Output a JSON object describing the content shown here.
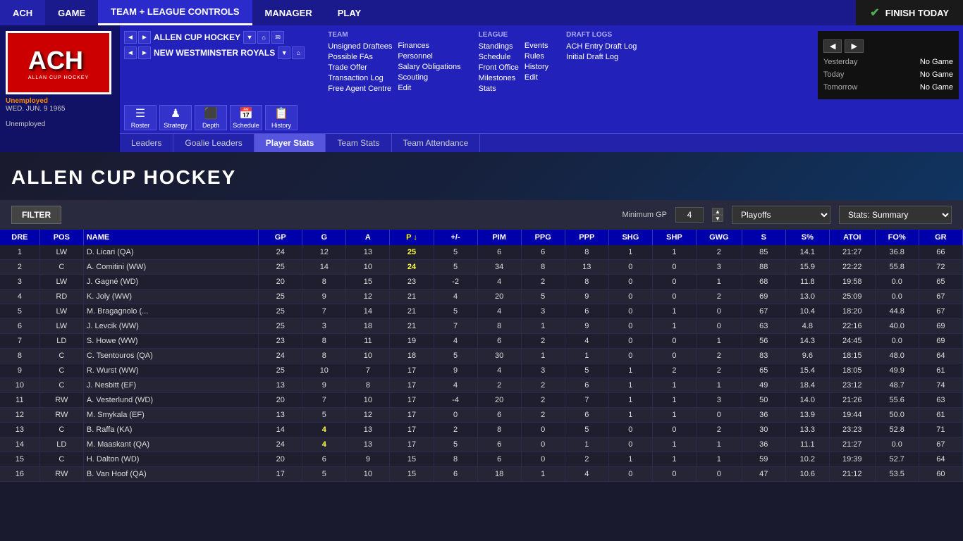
{
  "topNav": {
    "items": [
      {
        "id": "ach",
        "label": "ACH",
        "active": false
      },
      {
        "id": "game",
        "label": "GAME",
        "active": false
      },
      {
        "id": "team-league",
        "label": "TEAM + LEAGUE CONTROLS",
        "active": true
      },
      {
        "id": "manager",
        "label": "MANAGER",
        "active": false
      },
      {
        "id": "play",
        "label": "PLAY",
        "active": false
      }
    ],
    "finishToday": "FINISH TODAY"
  },
  "breadcrumbs": {
    "row1": {
      "text": "ALLEN CUP HOCKEY",
      "icons": [
        "▼",
        "⌂",
        "✉"
      ]
    },
    "row2": {
      "text": "NEW WESTMINSTER ROYALS",
      "icons": [
        "▼",
        "⌂"
      ]
    }
  },
  "iconButtons": [
    {
      "symbol": "☰",
      "label": "Roster"
    },
    {
      "symbol": "♟",
      "label": "Strategy"
    },
    {
      "symbol": "⬛",
      "label": "Depth"
    },
    {
      "symbol": "📅",
      "label": "Schedule"
    },
    {
      "symbol": "📋",
      "label": "History"
    }
  ],
  "teamMenu": {
    "title": "TEAM",
    "links": [
      "Unsigned Draftees",
      "Possible FAs",
      "Trade Offer",
      "Transaction Log",
      "Free Agent Centre"
    ]
  },
  "financesMenu": {
    "links": [
      "Finances",
      "Personnel",
      "Salary Obligations",
      "Scouting",
      "Edit"
    ]
  },
  "leagueMenu": {
    "title": "LEAGUE",
    "links": [
      "Standings",
      "Schedule",
      "Front Office",
      "Milestones",
      "Stats"
    ]
  },
  "eventsMenu": {
    "links": [
      "Events",
      "Rules",
      "History",
      "Edit"
    ]
  },
  "draftLogsMenu": {
    "title": "DRAFT LOGS",
    "links": [
      "ACH Entry Draft Log",
      "Initial Draft Log"
    ]
  },
  "sidebar": {
    "logoText": "ACH",
    "logoSubtitle": "ALLAN CUP HOCKEY",
    "userStatus": "Unemployed",
    "userDate": "WED. JUN. 9 1965",
    "userRole": "Unemployed"
  },
  "subNavTabs": [
    {
      "label": "Leaders",
      "active": false
    },
    {
      "label": "Goalie Leaders",
      "active": false
    },
    {
      "label": "Player Stats",
      "active": true
    },
    {
      "label": "Team Stats",
      "active": false
    },
    {
      "label": "Team Attendance",
      "active": false
    }
  ],
  "pageTitle": "ALLEN CUP HOCKEY",
  "filterBar": {
    "filterLabel": "FILTER",
    "minGpLabel": "Minimum GP",
    "minGpValue": "4",
    "playoffOption": "Playoffs",
    "statsOption": "Stats: Summary"
  },
  "finishTodayPanel": {
    "prevBtn": "◀",
    "nextBtn": "▶",
    "rows": [
      {
        "label": "Yesterday",
        "value": "No Game"
      },
      {
        "label": "Today",
        "value": "No Game"
      },
      {
        "label": "Tomorrow",
        "value": "No Game"
      }
    ]
  },
  "tableHeaders": [
    "DRE",
    "POS",
    "NAME",
    "GP",
    "G",
    "A",
    "P",
    "+/-",
    "PIM",
    "PPG",
    "PPP",
    "SHG",
    "SHP",
    "GWG",
    "S",
    "S%",
    "ATOI",
    "FO%",
    "GR"
  ],
  "tableRows": [
    {
      "dre": "1",
      "pos": "LW",
      "name": "D. Licari (QA)",
      "gp": "24",
      "g": "12",
      "a": "13",
      "p": "25",
      "pm": "5",
      "pim": "6",
      "ppg": "6",
      "ppp": "8",
      "shg": "1",
      "shp": "1",
      "gwg": "2",
      "s": "85",
      "sp": "14.1",
      "atoi": "21:27",
      "fop": "36.8",
      "gr": "66",
      "highlight_p": true
    },
    {
      "dre": "2",
      "pos": "C",
      "name": "A. Comitini (WW)",
      "gp": "25",
      "g": "14",
      "a": "10",
      "p": "24",
      "pm": "5",
      "pim": "34",
      "ppg": "8",
      "ppp": "13",
      "shg": "0",
      "shp": "0",
      "gwg": "3",
      "s": "88",
      "sp": "15.9",
      "atoi": "22:22",
      "fop": "55.8",
      "gr": "72",
      "highlight_p": true
    },
    {
      "dre": "3",
      "pos": "LW",
      "name": "J. Gagné (WD)",
      "gp": "20",
      "g": "8",
      "a": "15",
      "p": "23",
      "pm": "-2",
      "pim": "4",
      "ppg": "2",
      "ppp": "8",
      "shg": "0",
      "shp": "0",
      "gwg": "1",
      "s": "68",
      "sp": "11.8",
      "atoi": "19:58",
      "fop": "0.0",
      "gr": "65"
    },
    {
      "dre": "4",
      "pos": "RD",
      "name": "K. Joly (WW)",
      "gp": "25",
      "g": "9",
      "a": "12",
      "p": "21",
      "pm": "4",
      "pim": "20",
      "ppg": "5",
      "ppp": "9",
      "shg": "0",
      "shp": "0",
      "gwg": "2",
      "s": "69",
      "sp": "13.0",
      "atoi": "25:09",
      "fop": "0.0",
      "gr": "67",
      "highlight_pm": true
    },
    {
      "dre": "5",
      "pos": "LW",
      "name": "M. Bragagnolo (...",
      "gp": "25",
      "g": "7",
      "a": "14",
      "p": "21",
      "pm": "5",
      "pim": "4",
      "ppg": "3",
      "ppp": "6",
      "shg": "0",
      "shp": "1",
      "gwg": "0",
      "s": "67",
      "sp": "10.4",
      "atoi": "18:20",
      "fop": "44.8",
      "gr": "67"
    },
    {
      "dre": "6",
      "pos": "LW",
      "name": "J. Levcik (WW)",
      "gp": "25",
      "g": "3",
      "a": "18",
      "p": "21",
      "pm": "7",
      "pim": "8",
      "ppg": "1",
      "ppp": "9",
      "shg": "0",
      "shp": "1",
      "gwg": "0",
      "s": "63",
      "sp": "4.8",
      "atoi": "22:16",
      "fop": "40.0",
      "gr": "69"
    },
    {
      "dre": "7",
      "pos": "LD",
      "name": "S. Howe (WW)",
      "gp": "23",
      "g": "8",
      "a": "11",
      "p": "19",
      "pm": "4",
      "pim": "6",
      "ppg": "2",
      "ppp": "4",
      "shg": "0",
      "shp": "0",
      "gwg": "1",
      "s": "56",
      "sp": "14.3",
      "atoi": "24:45",
      "fop": "0.0",
      "gr": "69",
      "highlight_pm": true
    },
    {
      "dre": "8",
      "pos": "C",
      "name": "C. Tsentouros (QA)",
      "gp": "24",
      "g": "8",
      "a": "10",
      "p": "18",
      "pm": "5",
      "pim": "30",
      "ppg": "1",
      "ppp": "1",
      "shg": "0",
      "shp": "0",
      "gwg": "2",
      "s": "83",
      "sp": "9.6",
      "atoi": "18:15",
      "fop": "48.0",
      "gr": "64"
    },
    {
      "dre": "9",
      "pos": "C",
      "name": "R. Wurst (WW)",
      "gp": "25",
      "g": "10",
      "a": "7",
      "p": "17",
      "pm": "9",
      "pim": "4",
      "ppg": "3",
      "ppp": "5",
      "shg": "1",
      "shp": "2",
      "gwg": "2",
      "s": "65",
      "sp": "15.4",
      "atoi": "18:05",
      "fop": "49.9",
      "gr": "61"
    },
    {
      "dre": "10",
      "pos": "C",
      "name": "J. Nesbitt (EF)",
      "gp": "13",
      "g": "9",
      "a": "8",
      "p": "17",
      "pm": "4",
      "pim": "2",
      "ppg": "2",
      "ppp": "6",
      "shg": "1",
      "shp": "1",
      "gwg": "1",
      "s": "49",
      "sp": "18.4",
      "atoi": "23:12",
      "fop": "48.7",
      "gr": "74",
      "highlight_pm": true
    },
    {
      "dre": "11",
      "pos": "RW",
      "name": "A. Vesterlund (WD)",
      "gp": "20",
      "g": "7",
      "a": "10",
      "p": "17",
      "pm": "-4",
      "pim": "20",
      "ppg": "2",
      "ppp": "7",
      "shg": "1",
      "shp": "1",
      "gwg": "3",
      "s": "50",
      "sp": "14.0",
      "atoi": "21:26",
      "fop": "55.6",
      "gr": "63"
    },
    {
      "dre": "12",
      "pos": "RW",
      "name": "M. Smykala (EF)",
      "gp": "13",
      "g": "5",
      "a": "12",
      "p": "17",
      "pm": "0",
      "pim": "6",
      "ppg": "2",
      "ppp": "6",
      "shg": "1",
      "shp": "1",
      "gwg": "0",
      "s": "36",
      "sp": "13.9",
      "atoi": "19:44",
      "fop": "50.0",
      "gr": "61"
    },
    {
      "dre": "13",
      "pos": "C",
      "name": "B. Raffa (KA)",
      "gp": "14",
      "g": "4",
      "a": "13",
      "p": "17",
      "pm": "2",
      "pim": "8",
      "ppg": "0",
      "ppp": "5",
      "shg": "0",
      "shp": "0",
      "gwg": "2",
      "s": "30",
      "sp": "13.3",
      "atoi": "23:23",
      "fop": "52.8",
      "gr": "71",
      "highlight_g": true
    },
    {
      "dre": "14",
      "pos": "LD",
      "name": "M. Maaskant (QA)",
      "gp": "24",
      "g": "4",
      "a": "13",
      "p": "17",
      "pm": "5",
      "pim": "6",
      "ppg": "0",
      "ppp": "1",
      "shg": "0",
      "shp": "1",
      "gwg": "1",
      "s": "36",
      "sp": "11.1",
      "atoi": "21:27",
      "fop": "0.0",
      "gr": "67",
      "highlight_g": true
    },
    {
      "dre": "15",
      "pos": "C",
      "name": "H. Dalton (WD)",
      "gp": "20",
      "g": "6",
      "a": "9",
      "p": "15",
      "pm": "8",
      "pim": "6",
      "ppg": "0",
      "ppp": "2",
      "shg": "1",
      "shp": "1",
      "gwg": "1",
      "s": "59",
      "sp": "10.2",
      "atoi": "19:39",
      "fop": "52.7",
      "gr": "64"
    },
    {
      "dre": "16",
      "pos": "RW",
      "name": "B. Van Hoof (QA)",
      "gp": "17",
      "g": "5",
      "a": "10",
      "p": "15",
      "pm": "6",
      "pim": "18",
      "ppg": "1",
      "ppp": "4",
      "shg": "0",
      "shp": "0",
      "gwg": "0",
      "s": "47",
      "sp": "10.6",
      "atoi": "21:12",
      "fop": "53.5",
      "gr": "60"
    }
  ]
}
